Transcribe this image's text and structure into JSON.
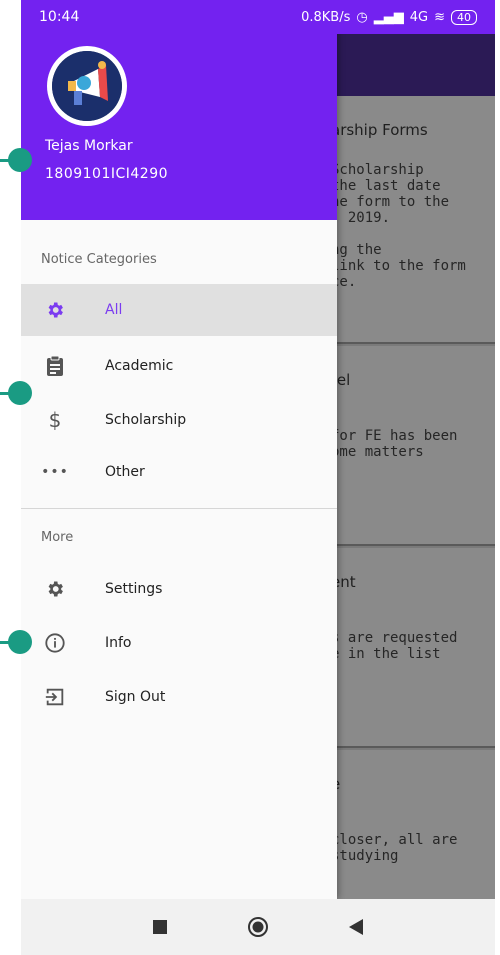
{
  "status_bar": {
    "time": "10:44",
    "speed": "0.8KB/s",
    "network": "4G",
    "battery": "40"
  },
  "drawer": {
    "user_name": "Tejas Morkar",
    "user_id": "1809101ICI4290",
    "sections": {
      "notice_categories": "Notice Categories",
      "more": "More"
    },
    "menu": {
      "all": "All",
      "academic": "Academic",
      "scholarship": "Scholarship",
      "other": "Other",
      "settings": "Settings",
      "info": "Info",
      "sign_out": "Sign Out"
    }
  },
  "background_cards": [
    {
      "title": "arship Forms",
      "body": [
        "Scholarship",
        "the last date",
        "he form to the",
        ", 2019.",
        "",
        "ng the",
        " link to the form",
        "ce."
      ]
    },
    {
      "title": "tel",
      "body": [
        "",
        "for FE has been",
        "ome matters"
      ]
    },
    {
      "title": "ent",
      "body": [
        "",
        "s are requested",
        "e in the list"
      ]
    },
    {
      "title": "e",
      "body": [
        "",
        "closer, all are",
        "studying"
      ]
    }
  ],
  "colors": {
    "primary": "#7322f0",
    "accent_active": "#7b3cf0",
    "annotation": "#1a9b83"
  }
}
